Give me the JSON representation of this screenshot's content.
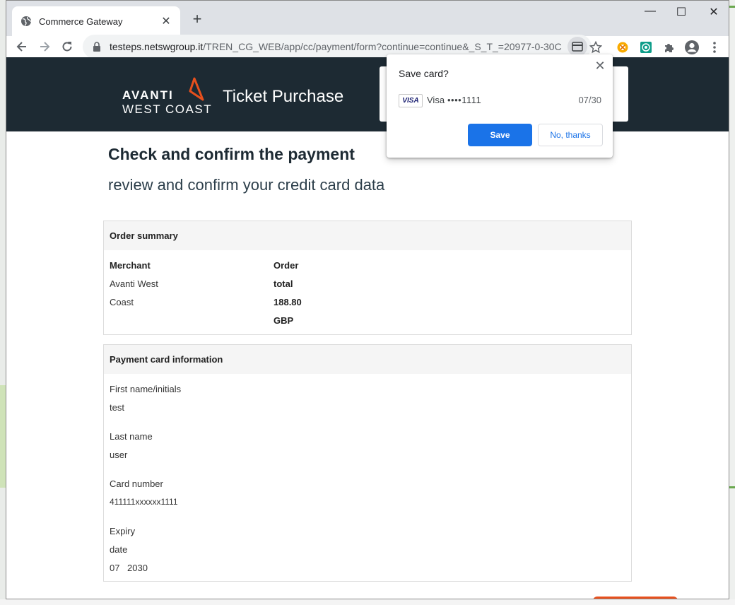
{
  "browser": {
    "tab_title": "Commerce Gateway",
    "new_tab": "+",
    "url_host": "testeps.netswgroup.it",
    "url_rest": "/TREN_CG_WEB/app/cc/payment/form?continue=continue&_S_T_=20977-0-30C...",
    "controls": {
      "minimize": "—",
      "maximize": "☐",
      "close": "✕"
    }
  },
  "header": {
    "logo_line1": "AVANTI",
    "logo_line2": "WEST COAST",
    "title": "Ticket Purchase"
  },
  "page": {
    "heading": "Check and confirm the payment",
    "subheading": "review and confirm your credit card data"
  },
  "order_summary": {
    "title": "Order summary",
    "merchant_label": "Merchant",
    "merchant_line1": "Avanti West",
    "merchant_line2": "Coast",
    "order_label": "Order",
    "total_label": "total",
    "amount": "188.80",
    "currency": "GBP"
  },
  "payment_info": {
    "title": "Payment card information",
    "first_name_label": "First name/initials",
    "first_name_value": "test",
    "last_name_label": "Last name",
    "last_name_value": "user",
    "card_number_label": "Card number",
    "card_number_value": "411111xxxxxx1111",
    "expiry_label_line1": "Expiry",
    "expiry_label_line2": "date",
    "expiry_month": "07",
    "expiry_year": "2030"
  },
  "save_card_popup": {
    "title": "Save card?",
    "card_brand_logo": "VISA",
    "card_brand": "Visa",
    "card_number": "••••1111",
    "expiry": "07/30",
    "save_label": "Save",
    "decline_label": "No, thanks"
  },
  "colors": {
    "header_bg": "#1d2a33",
    "accent_orange": "#e8501d",
    "save_blue": "#1a73e8"
  }
}
